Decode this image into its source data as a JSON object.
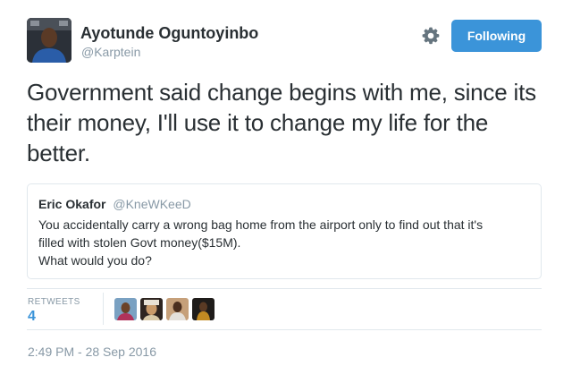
{
  "author": {
    "name": "Ayotunde Oguntoyinbo",
    "handle": "@Karptein"
  },
  "actions": {
    "settings_icon": "gear-icon",
    "follow_label": "Following",
    "accent_color": "#3b94d9"
  },
  "tweet": {
    "text": "Government said change begins with me, since its their money, I'll use it to change my life for the better."
  },
  "quoted_tweet": {
    "name": "Eric Okafor",
    "handle": "@KneWKeeD",
    "lines": [
      "You accidentally carry a wrong bag home from the airport only to find out that it's",
      "filled with stolen Govt money($15M).",
      "What would you do?"
    ]
  },
  "stats": {
    "retweets_label": "RETWEETS",
    "retweets_count": "4"
  },
  "retweeters": [
    {
      "icon": "retweeter-avatar"
    },
    {
      "icon": "retweeter-avatar"
    },
    {
      "icon": "retweeter-avatar"
    },
    {
      "icon": "retweeter-avatar"
    }
  ],
  "timestamp": "2:49 PM - 28 Sep 2016"
}
